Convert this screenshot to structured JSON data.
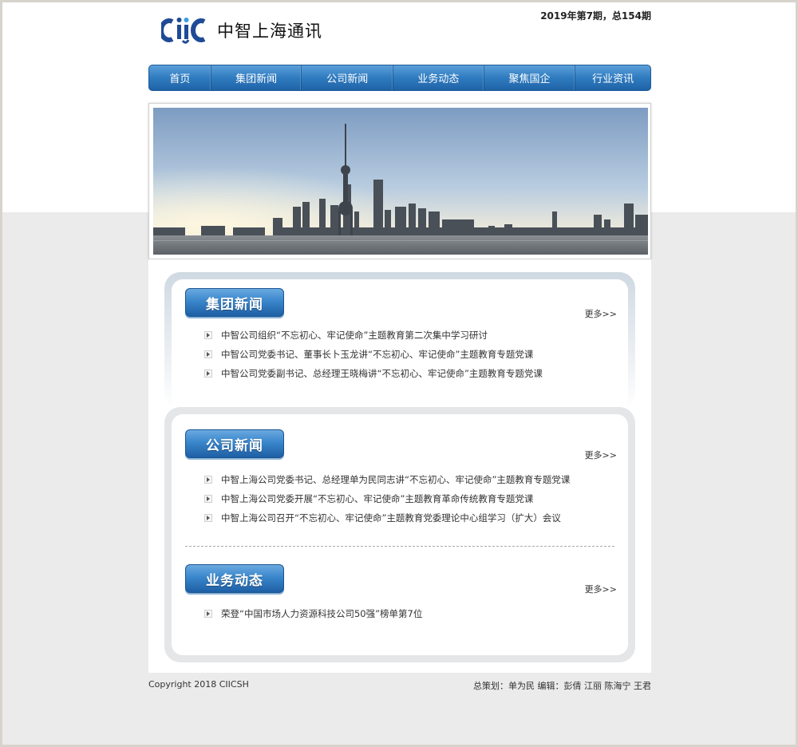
{
  "header": {
    "logo_text": "中智上海通讯",
    "issue": "2019年第7期，总154期"
  },
  "nav": [
    "首页",
    "集团新闻",
    "公司新闻",
    "业务动态",
    "聚焦国企",
    "行业资讯"
  ],
  "sections": {
    "group_news": {
      "title": "集团新闻",
      "more": "更多>>",
      "items": [
        "中智公司组织“不忘初心、牢记使命”主题教育第二次集中学习研讨",
        "中智公司党委书记、董事长卜玉龙讲“不忘初心、牢记使命”主题教育专题党课",
        "中智公司党委副书记、总经理王晓梅讲“不忘初心、牢记使命”主题教育专题党课"
      ]
    },
    "company_news": {
      "title": "公司新闻",
      "more": "更多>>",
      "items": [
        "中智上海公司党委书记、总经理单为民同志讲“不忘初心、牢记使命”主题教育专题党课",
        "中智上海公司党委开展“不忘初心、牢记使命”主题教育革命传统教育专题党课",
        "中智上海公司召开“不忘初心、牢记使命”主题教育党委理论中心组学习（扩大）会议"
      ]
    },
    "business": {
      "title": "业务动态",
      "more": "更多>>",
      "items": [
        "荣登“中国市场人力资源科技公司50强”榜单第7位"
      ]
    }
  },
  "footer": {
    "copyright": "Copyright 2018 CIICSH",
    "credits": "总策划：单为民 编辑：彭倩 江丽 陈海宁 王君"
  },
  "colors": {
    "nav_blue": "#2f7bc0",
    "logo_blue": "#1f4a96",
    "page_gray": "#ebebeb"
  }
}
